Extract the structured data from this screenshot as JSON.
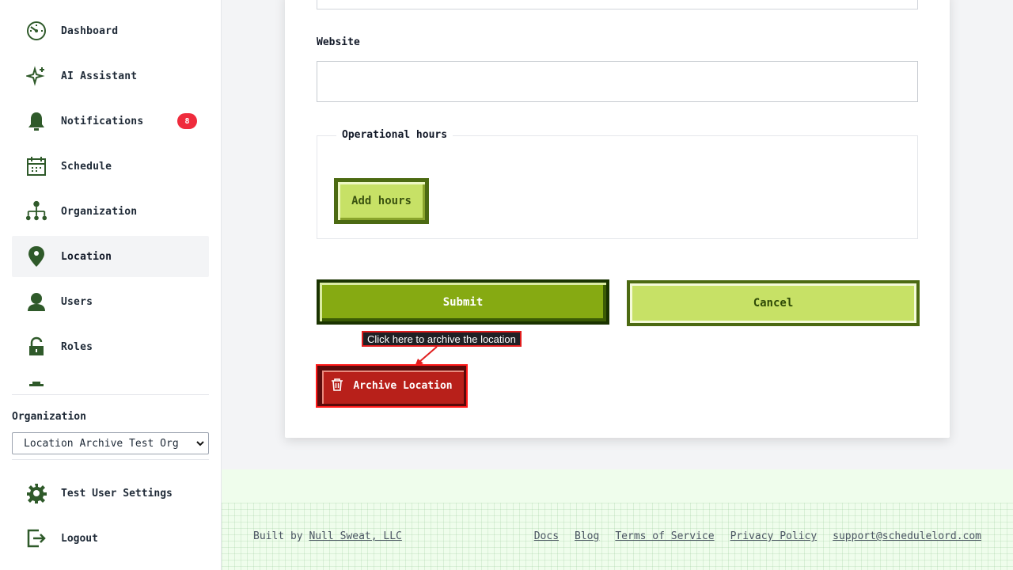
{
  "sidebar": {
    "items": [
      {
        "label": "Dashboard",
        "icon": "dashboard-icon"
      },
      {
        "label": "AI Assistant",
        "icon": "sparkle-icon"
      },
      {
        "label": "Notifications",
        "icon": "bell-icon",
        "badge": "8"
      },
      {
        "label": "Schedule",
        "icon": "calendar-icon"
      },
      {
        "label": "Organization",
        "icon": "org-chart-icon"
      },
      {
        "label": "Location",
        "icon": "location-pin-icon",
        "active": true
      },
      {
        "label": "Users",
        "icon": "user-icon"
      },
      {
        "label": "Roles",
        "icon": "lock-icon"
      }
    ],
    "org_label": "Organization",
    "org_selected": "Location Archive Test Org",
    "settings_label": "Test User Settings",
    "logout_label": "Logout"
  },
  "form": {
    "website_label": "Website",
    "website_value": "",
    "operational_hours_legend": "Operational hours",
    "add_hours_label": "Add hours",
    "submit_label": "Submit",
    "cancel_label": "Cancel",
    "archive_label": "Archive Location",
    "tooltip": "Click here to archive the location"
  },
  "footer": {
    "built_prefix": "Built by",
    "built_company": "Null Sweat, LLC",
    "links": [
      "Docs",
      "Blog",
      "Terms of Service",
      "Privacy Policy",
      "support@schedulelord.com"
    ]
  },
  "colors": {
    "icon_green": "#2f5a2a",
    "primary": "#86aa12",
    "secondary": "#c7e166",
    "danger": "#b8201a",
    "badge": "#ef2b3c"
  }
}
